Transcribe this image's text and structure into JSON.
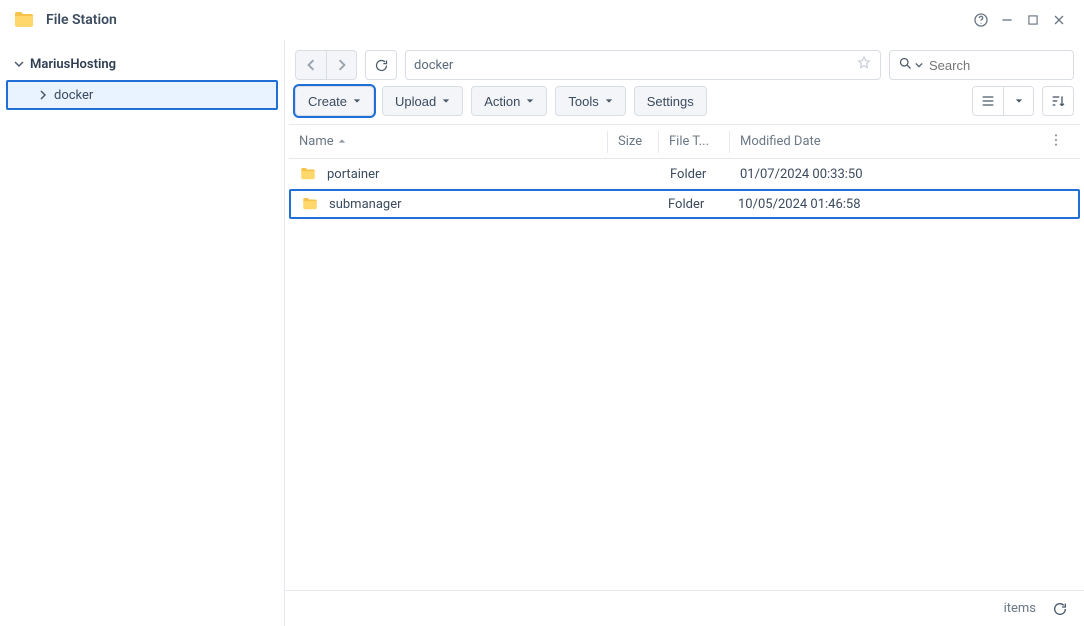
{
  "app": {
    "title": "File Station"
  },
  "sidebar": {
    "root": "MariusHosting",
    "child": "docker"
  },
  "path": {
    "value": "docker"
  },
  "search": {
    "placeholder": "Search"
  },
  "actions": {
    "create": "Create",
    "upload": "Upload",
    "action": "Action",
    "tools": "Tools",
    "settings": "Settings"
  },
  "columns": {
    "name": "Name",
    "size": "Size",
    "type": "File T...",
    "modified": "Modified Date"
  },
  "rows": [
    {
      "name": "portainer",
      "size": "",
      "type": "Folder",
      "modified": "01/07/2024 00:33:50",
      "highlight": false
    },
    {
      "name": "submanager",
      "size": "",
      "type": "Folder",
      "modified": "10/05/2024 01:46:58",
      "highlight": true
    }
  ],
  "status": {
    "items_label": "items"
  }
}
